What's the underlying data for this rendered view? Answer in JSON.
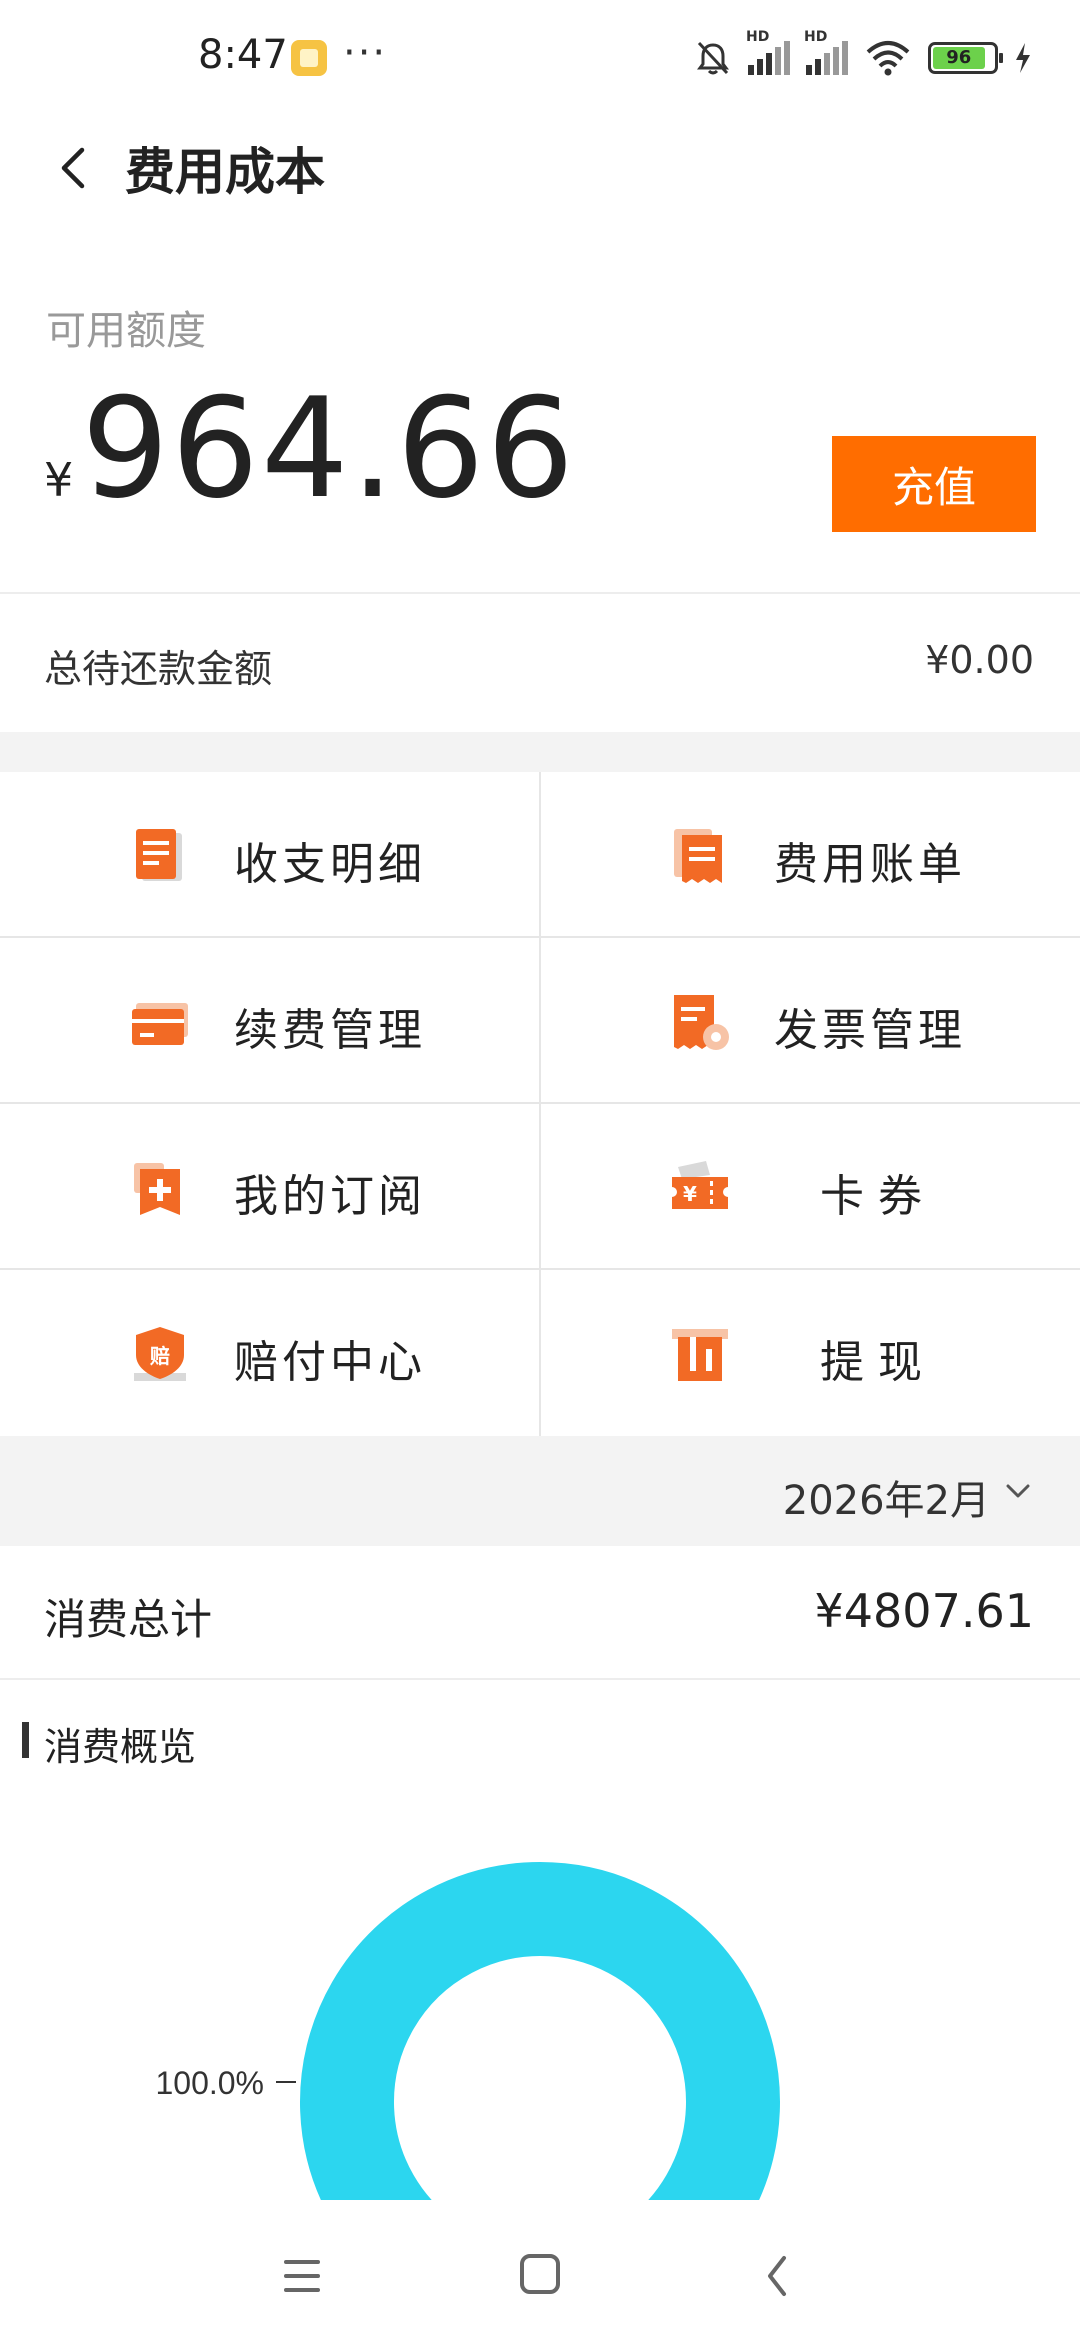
{
  "status_bar": {
    "time": "8:47",
    "dots": "···",
    "battery_level": "96",
    "network_badges": [
      "HD",
      "HD"
    ]
  },
  "header": {
    "title": "费用成本",
    "back_icon": "chevron-left-icon"
  },
  "balance": {
    "label": "可用额度",
    "currency_symbol": "¥",
    "amount": "964.66",
    "recharge_label": "充值"
  },
  "debt": {
    "label": "总待还款金额",
    "value": "¥0.00"
  },
  "menu": [
    {
      "label": "收支明细",
      "icon": "document-list-icon"
    },
    {
      "label": "费用账单",
      "icon": "bill-icon"
    },
    {
      "label": "续费管理",
      "icon": "card-icon"
    },
    {
      "label": "发票管理",
      "icon": "invoice-gear-icon"
    },
    {
      "label": "我的订阅",
      "icon": "subscription-plus-icon"
    },
    {
      "label": "卡券",
      "icon": "coupon-icon"
    },
    {
      "label": "赔付中心",
      "icon": "compensation-shield-icon"
    },
    {
      "label": "提现",
      "icon": "withdraw-icon"
    }
  ],
  "period": {
    "value": "2026年2月"
  },
  "consumption": {
    "total_label": "消费总计",
    "total_value": "¥4807.61",
    "section_title": "消费概览"
  },
  "colors": {
    "accent": "#ff6d00",
    "chart_ring": "#2cd6ef",
    "icon_orange": "#f26a25"
  },
  "chart_data": {
    "type": "pie",
    "variant": "donut",
    "slices": [
      {
        "label": "100.0%",
        "value": 100.0
      }
    ]
  }
}
